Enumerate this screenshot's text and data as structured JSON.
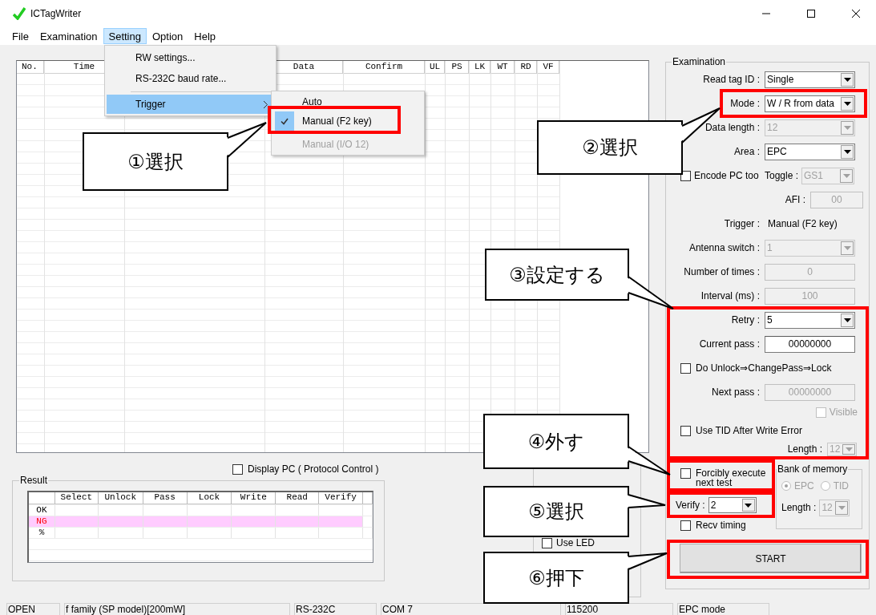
{
  "window": {
    "title": "ICTagWriter"
  },
  "menubar": [
    {
      "label": "File",
      "selected": false
    },
    {
      "label": "Examination",
      "selected": false
    },
    {
      "label": "Setting",
      "selected": true
    },
    {
      "label": "Option",
      "selected": false
    },
    {
      "label": "Help",
      "selected": false
    }
  ],
  "setting_menu": [
    {
      "label": "RW settings...",
      "highlighted": false,
      "submenu": false
    },
    {
      "label": "RS-232C baud rate...",
      "highlighted": false,
      "submenu": false
    },
    {
      "label": "Trigger",
      "highlighted": true,
      "submenu": true
    }
  ],
  "trigger_submenu": [
    {
      "label": "Auto",
      "checked": false,
      "disabled": false
    },
    {
      "label": "Manual (F2 key)",
      "checked": true,
      "disabled": false
    },
    {
      "label": "Manual (I/O 12)",
      "checked": false,
      "disabled": true
    }
  ],
  "log_table": {
    "columns": [
      "No.",
      "Time",
      "Data",
      "Confirm",
      "UL",
      "PS",
      "LK",
      "WT",
      "RD",
      "VF"
    ]
  },
  "display_pc": {
    "label": "Display PC ( Protocol Control )",
    "checked": false
  },
  "result": {
    "title": "Result",
    "columns": [
      "Select",
      "Unlock",
      "Pass",
      "Lock",
      "Write",
      "Read",
      "Verify"
    ],
    "rows": [
      {
        "label": "OK",
        "kind": "ok"
      },
      {
        "label": "NG",
        "kind": "ng"
      },
      {
        "label": "%",
        "kind": "plain"
      }
    ]
  },
  "option": {
    "use_led": {
      "label": "Use LED",
      "checked": false
    }
  },
  "examination": {
    "title": "Examination",
    "rows": [
      {
        "kind": "select",
        "label": "Read tag ID :",
        "value": "Single",
        "disabled": false
      },
      {
        "kind": "select",
        "label": "Mode :",
        "value": "W / R from data",
        "disabled": false
      },
      {
        "kind": "select",
        "label": "Data length :",
        "value": "12",
        "disabled": true
      },
      {
        "kind": "select",
        "label": "Area :",
        "value": "EPC",
        "disabled": false
      },
      {
        "kind": "check_select",
        "label": "Encode PC too",
        "checked": false,
        "select_label": "Toggle :",
        "value": "GS1",
        "disabled": true
      },
      {
        "kind": "short_input",
        "label": "AFI :",
        "value": "00",
        "disabled": true
      },
      {
        "kind": "text",
        "label": "Trigger :",
        "value": "Manual (F2 key)"
      },
      {
        "kind": "select",
        "label": "Antenna switch :",
        "value": "1",
        "disabled": true
      },
      {
        "kind": "input",
        "label": "Number of times :",
        "value": "0",
        "disabled": true
      },
      {
        "kind": "input",
        "label": "Interval (ms) :",
        "value": "100",
        "disabled": true
      },
      {
        "kind": "select",
        "label": "Retry :",
        "value": "5",
        "disabled": false
      },
      {
        "kind": "input",
        "label": "Current pass :",
        "value": "00000000",
        "disabled": false
      },
      {
        "kind": "check",
        "label": "Do Unlock⇒ChangePass⇒Lock",
        "checked": false,
        "disabled": false
      },
      {
        "kind": "input",
        "label": "Next pass :",
        "value": "00000000",
        "disabled": true
      },
      {
        "kind": "check_right",
        "label": "Visible",
        "checked": false,
        "disabled": true
      },
      {
        "kind": "check",
        "label": "Use TID After Write Error",
        "checked": false,
        "disabled": false
      },
      {
        "kind": "small_select",
        "label": "Length :",
        "value": "12",
        "disabled": true
      }
    ],
    "forcibly": {
      "label": "Forcibly execute next test",
      "checked": false
    },
    "verify": {
      "label": "Verify :",
      "value": "2"
    },
    "recv_timing": {
      "label": "Recv timing",
      "checked": false
    },
    "bank": {
      "title": "Bank of memory",
      "disabled": true,
      "options": [
        {
          "label": "EPC",
          "selected": true
        },
        {
          "label": "TID",
          "selected": false
        }
      ],
      "length_label": "Length :",
      "length_value": "12"
    },
    "start": "START"
  },
  "status_bar": [
    "OPEN",
    "f family (SP model)[200mW]",
    "RS-232C",
    "COM 7",
    "115200",
    "EPC mode"
  ],
  "annotations": [
    "①選択",
    "②選択",
    "③設定する",
    "④外す",
    "⑤選択",
    "⑥押下"
  ]
}
